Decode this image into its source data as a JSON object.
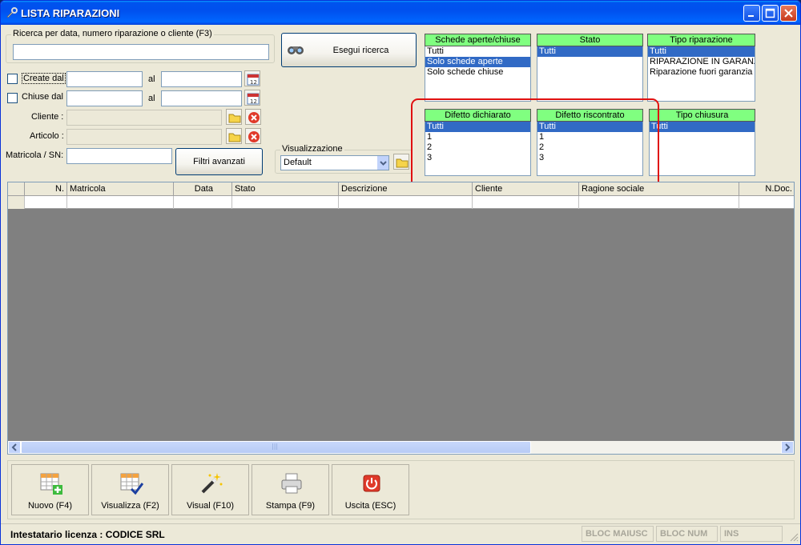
{
  "window": {
    "title": "LISTA RIPARAZIONI"
  },
  "search": {
    "group_label": "Ricerca per data, numero riparazione o cliente (F3)",
    "value": "",
    "button_label": "Esegui ricerca"
  },
  "filters": {
    "create_label": "Create dal",
    "chiuse_label": "Chiuse dal",
    "al_label": "al",
    "cliente_label": "Cliente :",
    "articolo_label": "Articolo :",
    "matricola_label": "Matricola / SN:",
    "advanced_button": "Filtri avanzati",
    "calendar_icon_text": "12"
  },
  "visualizzazione": {
    "label": "Visualizzazione",
    "selected": "Default"
  },
  "lists": {
    "schede": {
      "header": "Schede aperte/chiuse",
      "items": [
        "Tutti",
        "Solo schede aperte",
        "Solo schede chiuse"
      ]
    },
    "stato": {
      "header": "Stato",
      "items": [
        "Tutti"
      ]
    },
    "tipo_riparazione": {
      "header": "Tipo riparazione",
      "items": [
        "Tutti",
        "RIPARAZIONE IN GARANZ",
        "Riparazione fuori garanzia"
      ]
    },
    "difetto_dichiarato": {
      "header": "Difetto dichiarato",
      "items": [
        "Tutti",
        "1",
        "2",
        "3"
      ]
    },
    "difetto_riscontrato": {
      "header": "Difetto riscontrato",
      "items": [
        "Tutti",
        "1",
        "2",
        "3"
      ]
    },
    "tipo_chiusura": {
      "header": "Tipo chiusura",
      "items": [
        "Tutti"
      ]
    }
  },
  "grid": {
    "columns": [
      "",
      "N.",
      "Matricola",
      "Data",
      "Stato",
      "Descrizione",
      "Cliente",
      "Ragione sociale",
      "N.Doc."
    ],
    "scroll_grip": "|||"
  },
  "toolbar": {
    "nuovo": "Nuovo (F4)",
    "visualizza": "Visualizza (F2)",
    "visual": "Visual (F10)",
    "stampa": "Stampa (F9)",
    "uscita": "Uscita (ESC)"
  },
  "status": {
    "license": "Intestatario licenza : CODICE SRL",
    "caps": "BLOC MAIUSC",
    "num": "BLOC NUM",
    "ins": "INS"
  },
  "colors": {
    "list_header": "#80ff80",
    "selection": "#316ac5",
    "highlight_box": "#e01010"
  }
}
